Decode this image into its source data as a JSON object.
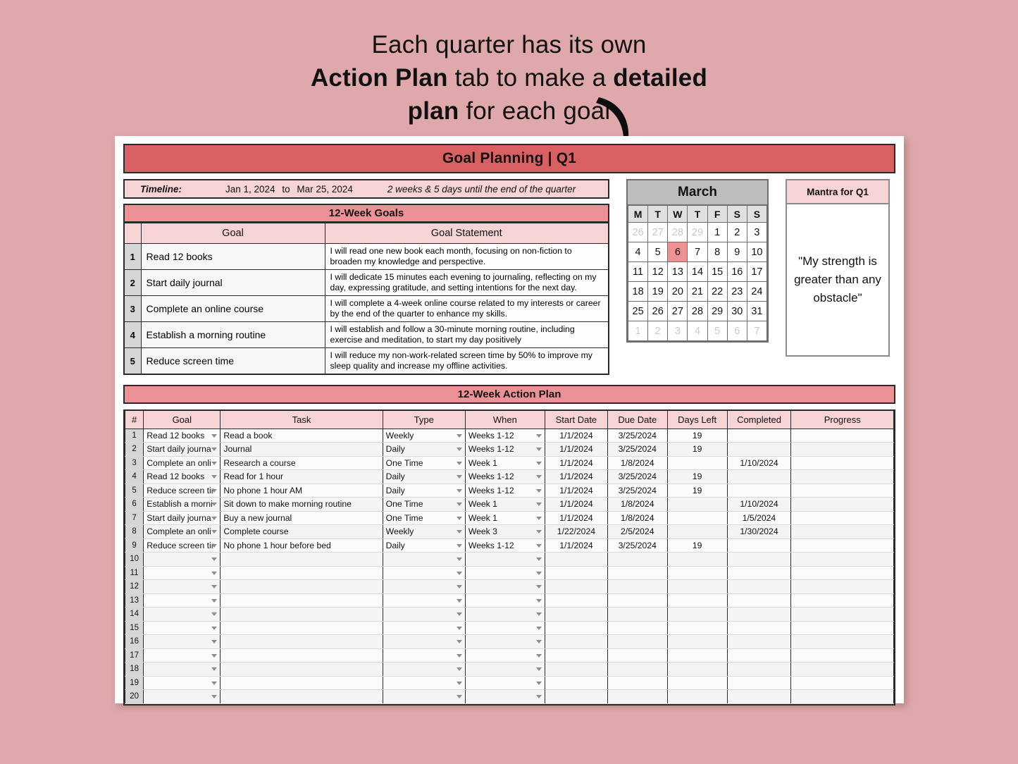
{
  "promo": {
    "line1": "Each quarter has its own",
    "line2_bold1": "Action Plan",
    "line2_mid": " tab to make a ",
    "line2_bold2": "detailed",
    "line3_bold": "plan",
    "line3_rest": " for each goal"
  },
  "sheet": {
    "title": "Goal Planning | Q1"
  },
  "timeline": {
    "label": "Timeline:",
    "start": "Jan 1, 2024",
    "to": "to",
    "end": "Mar 25, 2024",
    "note": "2 weeks & 5 days until the end of the quarter"
  },
  "goals_section": {
    "band": "12-Week Goals",
    "headers": [
      "Goal",
      "Goal Statement"
    ],
    "rows": [
      {
        "n": "1",
        "goal": "Read 12 books",
        "statement": "I will read one new book each month, focusing on non-fiction to broaden my knowledge and perspective."
      },
      {
        "n": "2",
        "goal": "Start daily journal",
        "statement": "I will dedicate 15 minutes each evening to journaling, reflecting on my day, expressing gratitude, and setting intentions for the next day."
      },
      {
        "n": "3",
        "goal": "Complete an online course",
        "statement": "I will complete a 4-week online course related to my interests or career by the end of the quarter to enhance my skills."
      },
      {
        "n": "4",
        "goal": "Establish a morning routine",
        "statement": "I will establish and follow a 30-minute morning routine, including exercise and meditation, to start my day positively"
      },
      {
        "n": "5",
        "goal": "Reduce screen time",
        "statement": "I will reduce my non-work-related screen time by 50% to improve my sleep quality and increase my offline activities."
      }
    ]
  },
  "calendar": {
    "month": "March",
    "daynames": [
      "M",
      "T",
      "W",
      "T",
      "F",
      "S",
      "S"
    ],
    "highlight_day": 6,
    "weeks": [
      [
        {
          "d": "26",
          "out": true
        },
        {
          "d": "27",
          "out": true
        },
        {
          "d": "28",
          "out": true
        },
        {
          "d": "29",
          "out": true
        },
        {
          "d": "1"
        },
        {
          "d": "2"
        },
        {
          "d": "3"
        }
      ],
      [
        {
          "d": "4"
        },
        {
          "d": "5"
        },
        {
          "d": "6",
          "today": true
        },
        {
          "d": "7"
        },
        {
          "d": "8"
        },
        {
          "d": "9"
        },
        {
          "d": "10"
        }
      ],
      [
        {
          "d": "11"
        },
        {
          "d": "12"
        },
        {
          "d": "13"
        },
        {
          "d": "14"
        },
        {
          "d": "15"
        },
        {
          "d": "16"
        },
        {
          "d": "17"
        }
      ],
      [
        {
          "d": "18"
        },
        {
          "d": "19"
        },
        {
          "d": "20"
        },
        {
          "d": "21"
        },
        {
          "d": "22"
        },
        {
          "d": "23"
        },
        {
          "d": "24"
        }
      ],
      [
        {
          "d": "25"
        },
        {
          "d": "26"
        },
        {
          "d": "27"
        },
        {
          "d": "28"
        },
        {
          "d": "29"
        },
        {
          "d": "30"
        },
        {
          "d": "31"
        }
      ],
      [
        {
          "d": "1",
          "out": true
        },
        {
          "d": "2",
          "out": true
        },
        {
          "d": "3",
          "out": true
        },
        {
          "d": "4",
          "out": true
        },
        {
          "d": "5",
          "out": true
        },
        {
          "d": "6",
          "out": true
        },
        {
          "d": "7",
          "out": true
        }
      ]
    ]
  },
  "mantra": {
    "header": "Mantra for Q1",
    "text": "\"My strength is greater than any obstacle\""
  },
  "action_plan": {
    "band": "12-Week Action Plan",
    "headers": [
      "#",
      "Goal",
      "Task",
      "Type",
      "When",
      "Start Date",
      "Due Date",
      "Days Left",
      "Completed",
      "Progress"
    ],
    "rows": [
      {
        "n": "1",
        "goal": "Read 12 books",
        "task": "Read a book",
        "type": "Weekly",
        "when": "Weeks 1-12",
        "start": "1/1/2024",
        "due": "3/25/2024",
        "days_left": "19",
        "completed": "",
        "progress": ""
      },
      {
        "n": "2",
        "goal": "Start daily journa",
        "task": "Journal",
        "type": "Daily",
        "when": "Weeks 1-12",
        "start": "1/1/2024",
        "due": "3/25/2024",
        "days_left": "19",
        "completed": "",
        "progress": ""
      },
      {
        "n": "3",
        "goal": "Complete an onli",
        "task": "Research a course",
        "type": "One Time",
        "when": "Week 1",
        "start": "1/1/2024",
        "due": "1/8/2024",
        "days_left": "",
        "completed": "1/10/2024",
        "progress": ""
      },
      {
        "n": "4",
        "goal": "Read 12 books",
        "task": "Read for 1 hour",
        "type": "Daily",
        "when": "Weeks 1-12",
        "start": "1/1/2024",
        "due": "3/25/2024",
        "days_left": "19",
        "completed": "",
        "progress": ""
      },
      {
        "n": "5",
        "goal": "Reduce screen tir",
        "task": "No phone 1 hour AM",
        "type": "Daily",
        "when": "Weeks 1-12",
        "start": "1/1/2024",
        "due": "3/25/2024",
        "days_left": "19",
        "completed": "",
        "progress": ""
      },
      {
        "n": "6",
        "goal": "Establish a morni",
        "task": "Sit down to make morning routine",
        "type": "One Time",
        "when": "Week 1",
        "start": "1/1/2024",
        "due": "1/8/2024",
        "days_left": "",
        "completed": "1/10/2024",
        "progress": ""
      },
      {
        "n": "7",
        "goal": "Start daily journa",
        "task": "Buy a new journal",
        "type": "One Time",
        "when": "Week 1",
        "start": "1/1/2024",
        "due": "1/8/2024",
        "days_left": "",
        "completed": "1/5/2024",
        "progress": ""
      },
      {
        "n": "8",
        "goal": "Complete an onli",
        "task": "Complete course",
        "type": "Weekly",
        "when": "Week 3",
        "start": "1/22/2024",
        "due": "2/5/2024",
        "days_left": "",
        "completed": "1/30/2024",
        "progress": ""
      },
      {
        "n": "9",
        "goal": "Reduce screen tir",
        "task": "No phone 1 hour before bed",
        "type": "Daily",
        "when": "Weeks 1-12",
        "start": "1/1/2024",
        "due": "3/25/2024",
        "days_left": "19",
        "completed": "",
        "progress": ""
      },
      {
        "n": "10",
        "goal": "",
        "task": "",
        "type": "",
        "when": "",
        "start": "",
        "due": "",
        "days_left": "",
        "completed": "",
        "progress": ""
      },
      {
        "n": "11",
        "goal": "",
        "task": "",
        "type": "",
        "when": "",
        "start": "",
        "due": "",
        "days_left": "",
        "completed": "",
        "progress": ""
      },
      {
        "n": "12",
        "goal": "",
        "task": "",
        "type": "",
        "when": "",
        "start": "",
        "due": "",
        "days_left": "",
        "completed": "",
        "progress": ""
      },
      {
        "n": "13",
        "goal": "",
        "task": "",
        "type": "",
        "when": "",
        "start": "",
        "due": "",
        "days_left": "",
        "completed": "",
        "progress": ""
      },
      {
        "n": "14",
        "goal": "",
        "task": "",
        "type": "",
        "when": "",
        "start": "",
        "due": "",
        "days_left": "",
        "completed": "",
        "progress": ""
      },
      {
        "n": "15",
        "goal": "",
        "task": "",
        "type": "",
        "when": "",
        "start": "",
        "due": "",
        "days_left": "",
        "completed": "",
        "progress": ""
      },
      {
        "n": "16",
        "goal": "",
        "task": "",
        "type": "",
        "when": "",
        "start": "",
        "due": "",
        "days_left": "",
        "completed": "",
        "progress": ""
      },
      {
        "n": "17",
        "goal": "",
        "task": "",
        "type": "",
        "when": "",
        "start": "",
        "due": "",
        "days_left": "",
        "completed": "",
        "progress": ""
      },
      {
        "n": "18",
        "goal": "",
        "task": "",
        "type": "",
        "when": "",
        "start": "",
        "due": "",
        "days_left": "",
        "completed": "",
        "progress": ""
      },
      {
        "n": "19",
        "goal": "",
        "task": "",
        "type": "",
        "when": "",
        "start": "",
        "due": "",
        "days_left": "",
        "completed": "",
        "progress": ""
      },
      {
        "n": "20",
        "goal": "",
        "task": "",
        "type": "",
        "when": "",
        "start": "",
        "due": "",
        "days_left": "",
        "completed": "",
        "progress": ""
      }
    ]
  },
  "colors": {
    "page_background": "#dfa9ab",
    "title_red": "#d85f62",
    "band_pink": "#ec9296",
    "header_pink": "#f6d3d5",
    "calendar_head_gray": "#bdbdbd",
    "today_highlight": "#ef9093"
  }
}
